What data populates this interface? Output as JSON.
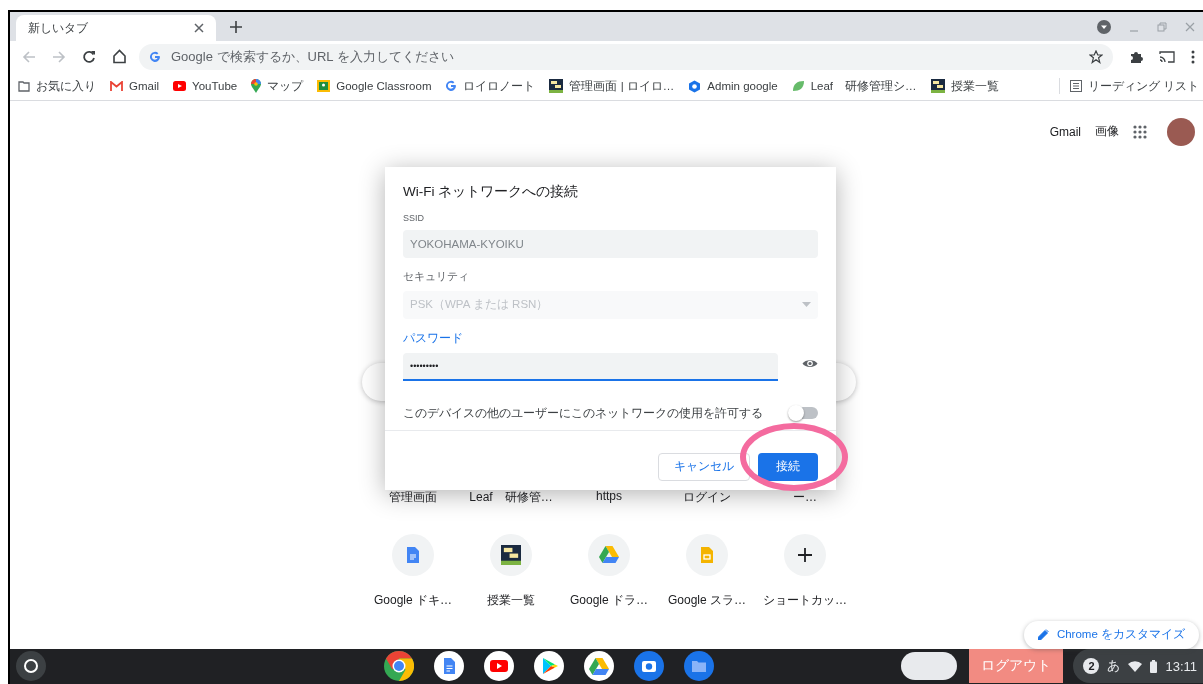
{
  "tabs": [
    {
      "label": "新しいタブ",
      "selected": true
    }
  ],
  "omnibox": {
    "placeholder": "Google で検索するか、URL を入力してください"
  },
  "bookmarks": [
    {
      "label": "お気に入り",
      "kind": "folder"
    },
    {
      "label": "Gmail",
      "kind": "gmail"
    },
    {
      "label": "YouTube",
      "kind": "youtube"
    },
    {
      "label": "マップ",
      "kind": "maps"
    },
    {
      "label": "Google Classroom",
      "kind": "classroom"
    },
    {
      "label": "ロイロノート",
      "kind": "google"
    },
    {
      "label": "管理画面 | ロイロ…",
      "kind": "board"
    },
    {
      "label": "Admin google",
      "kind": "admin"
    },
    {
      "label": "Leaf　研修管理シ…",
      "kind": "leaf"
    },
    {
      "label": "授業一覧",
      "kind": "board"
    }
  ],
  "reading_list": "リーディング リスト",
  "header_links": [
    "Gmail",
    "画像"
  ],
  "dialog": {
    "title": "Wi-Fi ネットワークへの接続",
    "ssid_label": "SSID",
    "ssid_value": "YOKOHAMA-KYOIKU",
    "security_label": "セキュリティ",
    "security_value": "PSK（WPA または RSN）",
    "password_label": "パスワード",
    "password_value": "•••••••••",
    "share_label": "このデバイスの他のユーザーにこのネットワークの使用を許可する",
    "share_on": false,
    "cancel": "キャンセル",
    "connect": "接続"
  },
  "shortcut_labels_top": [
    "管理画面",
    "Leaf　研修管…",
    "https",
    "ログイン",
    "ー…"
  ],
  "shortcuts": [
    {
      "label": "Google ドキ…",
      "kind": "docs"
    },
    {
      "label": "授業一覧",
      "kind": "board"
    },
    {
      "label": "Google ドラ…",
      "kind": "drive"
    },
    {
      "label": "Google スラ…",
      "kind": "slides"
    },
    {
      "label": "ショートカッ…",
      "kind": "add"
    }
  ],
  "customize": "Chrome をカスタマイズ",
  "shelf": {
    "apps": [
      {
        "kind": "chrome"
      },
      {
        "kind": "docs"
      },
      {
        "kind": "youtube"
      },
      {
        "kind": "play"
      },
      {
        "kind": "drive"
      },
      {
        "kind": "camera"
      },
      {
        "kind": "files"
      }
    ],
    "logout": "ログアウト",
    "notifications": "2",
    "ime": "あ",
    "time": "13:11"
  }
}
